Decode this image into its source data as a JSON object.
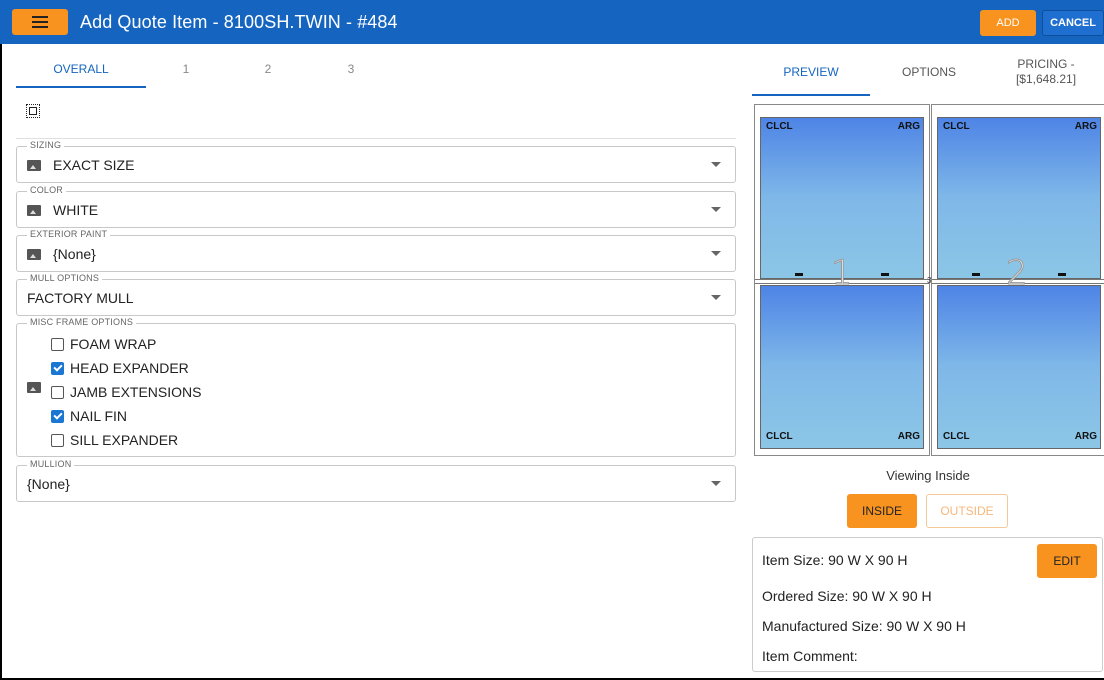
{
  "header": {
    "title": "Add Quote Item - 8100SH.TWIN - #484",
    "add_label": "ADD",
    "cancel_label": "CANCEL",
    "bar_color": "#1565c0",
    "accent_color": "#f7931e"
  },
  "left_tabs": [
    {
      "label": "OVERALL",
      "active": true
    },
    {
      "label": "1",
      "active": false
    },
    {
      "label": "2",
      "active": false
    },
    {
      "label": "3",
      "active": false
    }
  ],
  "fields": {
    "sizing": {
      "legend": "SIZING",
      "value": "EXACT SIZE"
    },
    "color": {
      "legend": "COLOR",
      "value": "WHITE"
    },
    "exterior_paint": {
      "legend": "EXTERIOR PAINT",
      "value": "{None}"
    },
    "mull_options": {
      "legend": "MULL OPTIONS",
      "value": "FACTORY MULL"
    },
    "misc_frame": {
      "legend": "MISC FRAME OPTIONS",
      "options": [
        {
          "label": "FOAM WRAP",
          "checked": false
        },
        {
          "label": "HEAD EXPANDER",
          "checked": true
        },
        {
          "label": "JAMB EXTENSIONS",
          "checked": false
        },
        {
          "label": "NAIL FIN",
          "checked": true
        },
        {
          "label": "SILL EXPANDER",
          "checked": false
        }
      ]
    },
    "mullion": {
      "legend": "MULLION",
      "value": "{None}"
    }
  },
  "right_tabs": [
    {
      "label": "PREVIEW",
      "active": true
    },
    {
      "label": "OPTIONS",
      "active": false
    },
    {
      "label": "PRICING -\n[$1,648.21]",
      "active": false
    }
  ],
  "preview": {
    "glass_top": "CLCL",
    "gas_top": "ARG",
    "glass_bottom": "CLCL",
    "gas_bottom": "ARG",
    "unit_1": "1",
    "unit_2": "2",
    "mull_number": "3",
    "viewing": "Viewing Inside",
    "inside_label": "INSIDE",
    "outside_label": "OUTSIDE"
  },
  "info": {
    "item_size": "Item Size:  90 W X 90 H",
    "ordered_size": "Ordered Size:  90 W X 90 H",
    "manufactured_size": "Manufactured Size:  90 W X 90 H",
    "item_comment": "Item Comment:",
    "edit_label": "EDIT"
  }
}
